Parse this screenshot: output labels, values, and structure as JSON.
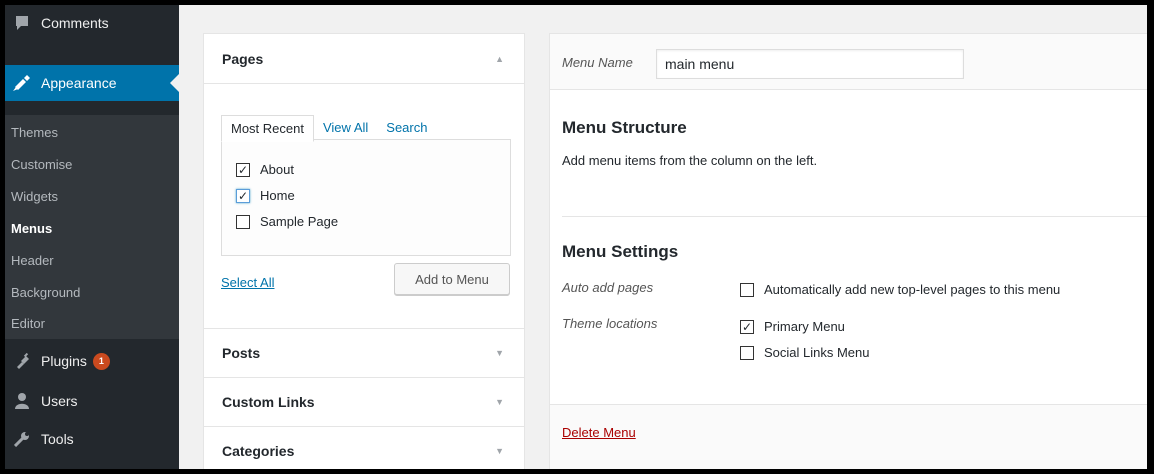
{
  "sidebar": {
    "items": [
      {
        "label": "Comments",
        "icon": "comment-icon"
      },
      {
        "label": "Appearance",
        "icon": "brush-icon"
      },
      {
        "label": "Plugins",
        "icon": "plugin-icon",
        "badge": "1"
      },
      {
        "label": "Users",
        "icon": "user-icon"
      },
      {
        "label": "Tools",
        "icon": "wrench-icon"
      }
    ],
    "submenu": [
      "Themes",
      "Customise",
      "Widgets",
      "Menus",
      "Header",
      "Background",
      "Editor"
    ],
    "current_submenu": "Menus"
  },
  "accordion": {
    "pages": {
      "title": "Pages",
      "tabs": [
        "Most Recent",
        "View All",
        "Search"
      ],
      "active_tab": "Most Recent",
      "items": [
        {
          "label": "About",
          "checked": true
        },
        {
          "label": "Home",
          "checked": true
        },
        {
          "label": "Sample Page",
          "checked": false
        }
      ],
      "select_all": "Select All",
      "add_button": "Add to Menu"
    },
    "sections": [
      "Posts",
      "Custom Links",
      "Categories"
    ]
  },
  "editor": {
    "menu_name_label": "Menu Name",
    "menu_name_value": "main menu",
    "structure_title": "Menu Structure",
    "structure_desc": "Add menu items from the column on the left.",
    "settings_title": "Menu Settings",
    "auto_add_label": "Auto add pages",
    "auto_add_option": {
      "label": "Automatically add new top-level pages to this menu",
      "checked": false
    },
    "theme_locations_label": "Theme locations",
    "locations": [
      {
        "label": "Primary Menu",
        "checked": true
      },
      {
        "label": "Social Links Menu",
        "checked": false
      }
    ],
    "delete_label": "Delete Menu"
  },
  "colors": {
    "sidebar_bg": "#23282d",
    "submenu_bg": "#32373c",
    "accent": "#0073aa",
    "badge": "#ca4a1f",
    "delete": "#a00000"
  }
}
